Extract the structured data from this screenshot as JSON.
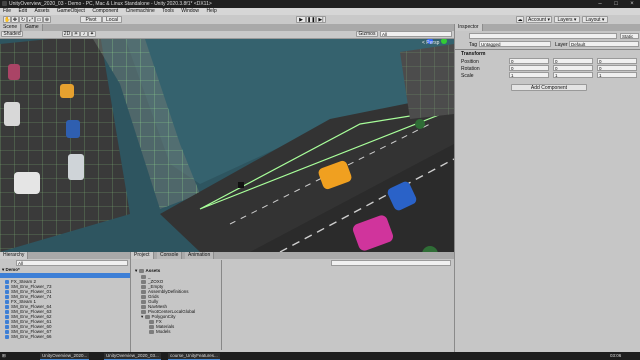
{
  "window": {
    "title": "UnityOverview_2020_03 - Demo - PC, Mac & Linux Standalone - Unity 2020.3.8f1* <DX11>"
  },
  "menu": [
    "File",
    "Edit",
    "Assets",
    "GameObject",
    "Component",
    "Cinemachine",
    "Tools",
    "Window",
    "Help"
  ],
  "toolbar": {
    "pivot_label": "Pivot",
    "local_label": "Local",
    "account_label": "Account",
    "layers_label": "Layers",
    "layout_label": "Layout"
  },
  "scene_panel": {
    "tabs": [
      "Scene",
      "Game"
    ],
    "shading_mode": "Shaded",
    "mode_2d": "2D",
    "gizmos_label": "Gizmos",
    "search_placeholder": "All",
    "persp_label": "< Persp"
  },
  "inspector": {
    "tab_label": "Inspector",
    "static_label": "Static",
    "tag_label": "Tag",
    "tag_value": "Untagged",
    "layer_label": "Layer",
    "layer_value": "Default",
    "component_title": "Transform",
    "position_label": "Position",
    "rotation_label": "Rotation",
    "scale_label": "Scale",
    "position": [
      "0",
      "0",
      "0"
    ],
    "rotation": [
      "0",
      "0",
      "0"
    ],
    "scale": [
      "1",
      "1",
      "1"
    ],
    "add_component_label": "Add Component"
  },
  "hierarchy": {
    "tab_label": "Hierarchy",
    "search_placeholder": "All",
    "scene_name": "Demo*",
    "items": [
      "FX_Steam 2",
      "SM_Env_Flower_73",
      "SM_Env_Flower_01",
      "SM_Env_Flower_74",
      "FX_Steam 1",
      "SM_Env_Flower_64",
      "SM_Env_Flower_63",
      "SM_Env_Flower_62",
      "SM_Env_Flower_61",
      "SM_Env_Flower_60",
      "SM_Env_Flower_67",
      "SM_Env_Flower_66"
    ]
  },
  "project": {
    "tabs": [
      "Project",
      "Console",
      "Animation"
    ],
    "root": "Assets",
    "folders": [
      "_",
      "_ZOXO",
      "_Empty",
      "AssemblyDefinitions",
      "Grids",
      "Gully",
      "NavMesh",
      "PivotCenterLocalGlobal",
      "PolygonCity",
      "FX",
      "Materials",
      "Models"
    ]
  },
  "taskbar": {
    "apps": [
      "UnityOverview_2020...",
      "UnityOverview_2020_03...",
      "course_UnityFeatures..."
    ],
    "clock": "03:06"
  },
  "colors": {
    "selection": "#3d7fd6",
    "wireframe": "#a8ff9a",
    "water": "#2e5560"
  }
}
